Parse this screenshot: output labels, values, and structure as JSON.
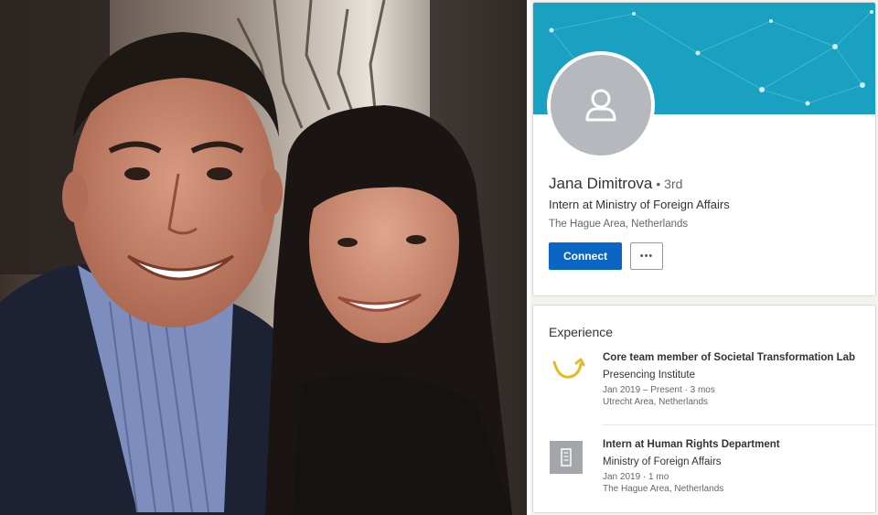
{
  "profile": {
    "name": "Jana Dimitrova",
    "degree": "• 3rd",
    "headline": "Intern at Ministry of Foreign Affairs",
    "location": "The Hague Area, Netherlands",
    "connect_label": "Connect",
    "more_label": "•••"
  },
  "experience": {
    "title": "Experience",
    "items": [
      {
        "title": "Core team member of Societal Transformation Lab",
        "company": "Presencing Institute",
        "dates": "Jan 2019 – Present · 3 mos",
        "location": "Utrecht Area, Netherlands",
        "logo_icon": "presencing-institute-logo"
      },
      {
        "title": "Intern at Human Rights Department",
        "company": "Ministry of Foreign Affairs",
        "dates": "Jan 2019 · 1 mo",
        "location": "The Hague Area, Netherlands",
        "logo_icon": "company-placeholder-logo"
      }
    ]
  },
  "colors": {
    "banner": "#1aa0c0",
    "connect_button": "#0a66c2",
    "avatar_bg": "#b5b8bc",
    "logo_accent": "#e8b821"
  }
}
